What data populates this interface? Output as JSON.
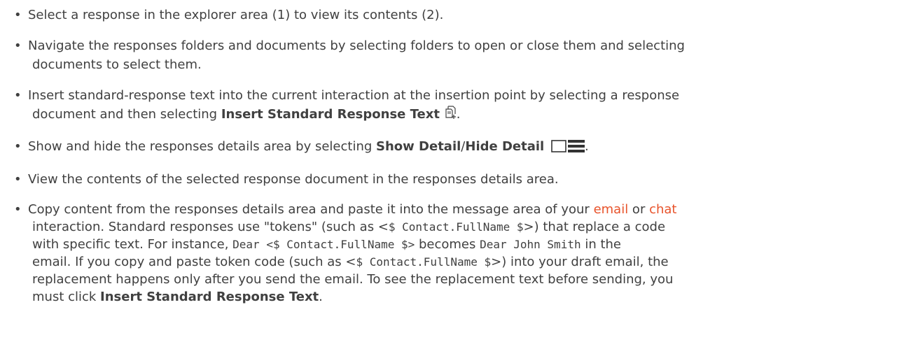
{
  "items": [
    {
      "text": "Select a response in the explorer area (1) to view its contents (2)."
    },
    {
      "line1": "Navigate the responses folders and documents by selecting folders to open or close them and selecting",
      "line2": "documents to select them."
    },
    {
      "line1": "Insert standard-response text into the current interaction at the insertion point by selecting a response",
      "line2_pre": "document and then selecting ",
      "bold": "Insert Standard Response Text",
      "post": "."
    },
    {
      "pre": "Show and hide the responses details area by selecting ",
      "bold1": "Show Detail",
      "slash": "/",
      "bold2": "Hide Detail",
      "post": "."
    },
    {
      "text": "View the contents of the selected response document in the responses details area."
    },
    {
      "l1_pre": "Copy content from the responses details area and paste it into the message area of your ",
      "link_email": "email",
      "l1_or": " or ",
      "link_chat": "chat",
      "l2_pre": "interaction. Standard responses use \"tokens\" (such as <",
      "token1": "$ Contact.FullName $",
      "l2_post": ">) that replace a code",
      "l3_pre": "with specific text. For instance, ",
      "code_dear1": "Dear <$ Contact.FullName $>",
      "l3_mid": " becomes ",
      "code_dear2": "Dear John Smith",
      "l3_post": " in the",
      "l4_pre": "email. If you copy and paste token code (such as <",
      "token2": "$ Contact.FullName $",
      "l4_post": ">) into your draft email, the",
      "l5": "replacement happens only after you send the email. To see the replacement text before sending, you",
      "l6_pre": "must click ",
      "bold": "Insert Standard Response Text",
      "post": "."
    }
  ],
  "bullet_char": "•",
  "icons": {
    "insert": "insert-standard-response-icon",
    "show": "show-detail-icon",
    "hide": "hide-detail-icon"
  },
  "colors": {
    "text": "#404040",
    "link": "#e8532b"
  }
}
